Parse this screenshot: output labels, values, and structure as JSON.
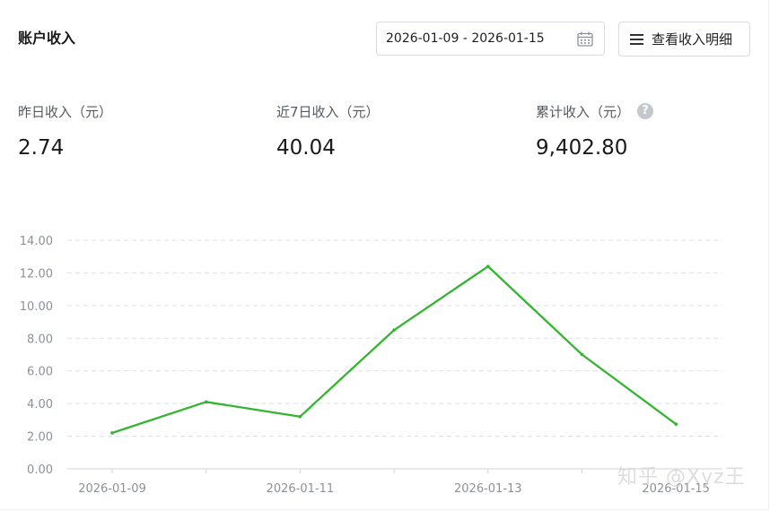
{
  "header": {
    "title": "账户收入",
    "date_range": "2026-01-09 - 2026-01-15",
    "detail_button_label": "查看收入明细"
  },
  "stats": [
    {
      "label": "昨日收入（元）",
      "value": "2.74"
    },
    {
      "label": "近7日收入（元）",
      "value": "40.04"
    },
    {
      "label": "累计收入（元）",
      "value": "9,402.80"
    }
  ],
  "icons": {
    "calendar": "calendar-icon",
    "menu": "list-menu-icon",
    "help": "question-circle-icon"
  },
  "help_glyph": "?",
  "watermark": "知乎 @Xyz王",
  "colors": {
    "line": "#33b52f",
    "grid": "#dcdfe3",
    "axis_text": "#8c9199"
  },
  "chart_data": {
    "type": "line",
    "x": [
      "2026-01-09",
      "2026-01-10",
      "2026-01-11",
      "2026-01-12",
      "2026-01-13",
      "2026-01-14",
      "2026-01-15"
    ],
    "x_tick_labels": [
      "2026-01-09",
      "2026-01-11",
      "2026-01-13",
      "2026-01-15"
    ],
    "series": [
      {
        "values": [
          2.2,
          4.1,
          3.2,
          8.5,
          12.4,
          7.0,
          2.74
        ]
      }
    ],
    "y_ticks": [
      "0.00",
      "2.00",
      "4.00",
      "6.00",
      "8.00",
      "10.00",
      "12.00",
      "14.00"
    ],
    "ylim": [
      0,
      14
    ],
    "grid": true,
    "title": "",
    "xlabel": "",
    "ylabel": ""
  }
}
